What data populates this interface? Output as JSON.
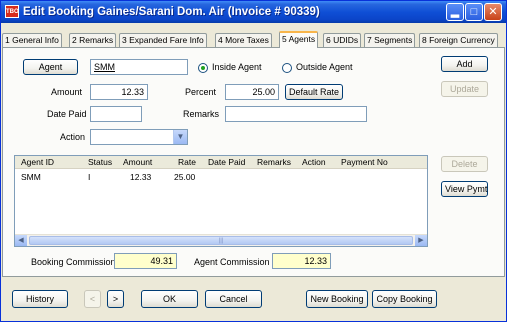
{
  "window": {
    "title": "Edit Booking Gaines/Sarani  Dom. Air (Invoice # 90339)",
    "app_icon": "TBO"
  },
  "tabs": [
    {
      "label": "1 General Info"
    },
    {
      "label": "2 Remarks"
    },
    {
      "label": "3 Expanded Fare Info"
    },
    {
      "label": "4 More Taxes"
    },
    {
      "label": "5 Agents",
      "active": true
    },
    {
      "label": "6 UDIDs"
    },
    {
      "label": "7 Segments"
    },
    {
      "label": "8 Foreign Currency"
    }
  ],
  "form": {
    "agent_button": "Agent",
    "agent_value": "SMM",
    "inside_agent_label": "Inside Agent",
    "outside_agent_label": "Outside Agent",
    "selected_agent_type": "inside",
    "amount_label": "Amount",
    "amount_value": "12.33",
    "percent_label": "Percent",
    "percent_value": "25.00",
    "default_rate_button": "Default Rate",
    "date_paid_label": "Date Paid",
    "date_paid_value": "",
    "remarks_label": "Remarks",
    "remarks_value": "",
    "action_label": "Action",
    "action_value": ""
  },
  "side_buttons": {
    "add": "Add",
    "update": "Update",
    "delete": "Delete",
    "view_pymt": "View Pymt"
  },
  "grid": {
    "columns": [
      "Agent ID",
      "Status",
      "Amount",
      "Rate",
      "Date Paid",
      "Remarks",
      "Action",
      "Payment No"
    ],
    "rows": [
      {
        "agent_id": "SMM",
        "status": "I",
        "amount": "12.33",
        "rate": "25.00",
        "date_paid": "",
        "remarks": "",
        "action": "",
        "payment_no": ""
      }
    ]
  },
  "commissions": {
    "booking_label": "Booking Commission",
    "booking_value": "49.31",
    "agent_label": "Agent Commission",
    "agent_value": "12.33"
  },
  "bottom_buttons": {
    "history": "History",
    "prev": "<",
    "next": ">",
    "ok": "OK",
    "cancel": "Cancel",
    "new_booking": "New Booking",
    "copy_booking": "Copy Booking"
  },
  "colors": {
    "titlebar": "#0b44c8",
    "highlight_field": "#ffffcc",
    "active_tab_accent": "#f8b54a"
  }
}
